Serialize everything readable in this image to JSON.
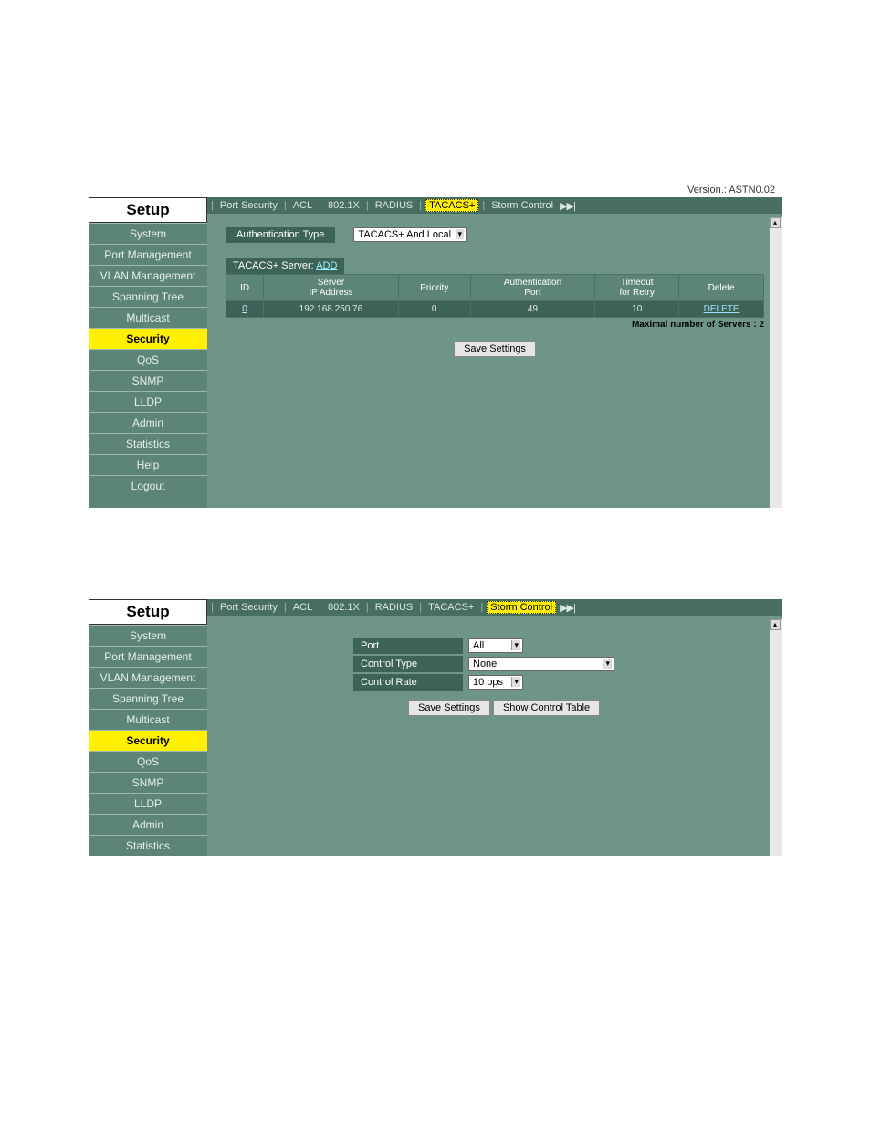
{
  "shared": {
    "sidebar_title": "Setup",
    "version_label": "Version.: ASTN0.02",
    "sidebar_items": [
      "System",
      "Port Management",
      "VLAN Management",
      "Spanning Tree",
      "Multicast",
      "Security",
      "QoS",
      "SNMP",
      "LLDP",
      "Admin",
      "Statistics",
      "Help",
      "Logout"
    ],
    "tabs": [
      "Port Security",
      "ACL",
      "802.1X",
      "RADIUS",
      "TACACS+",
      "Storm Control"
    ]
  },
  "fig1": {
    "auth_type_label": "Authentication Type",
    "auth_type_value": "TACACS+ And Local",
    "server_header": "TACACS+ Server:",
    "add_label": "ADD",
    "cols": {
      "id": "ID",
      "ip": "Server\nIP Address",
      "prio": "Priority",
      "port": "Authentication\nPort",
      "timeout": "Timeout\nfor Retry",
      "del": "Delete"
    },
    "row": {
      "id": "0",
      "ip": "192.168.250.76",
      "prio": "0",
      "port": "49",
      "timeout": "10",
      "del": "DELETE"
    },
    "max_note": "Maximal number of Servers : 2",
    "save_btn": "Save Settings"
  },
  "fig2": {
    "port_label": "Port",
    "port_value": "All",
    "ctype_label": "Control Type",
    "ctype_value": "None",
    "crate_label": "Control Rate",
    "crate_value": "10 pps",
    "save_btn": "Save Settings",
    "show_btn": "Show Control Table"
  }
}
